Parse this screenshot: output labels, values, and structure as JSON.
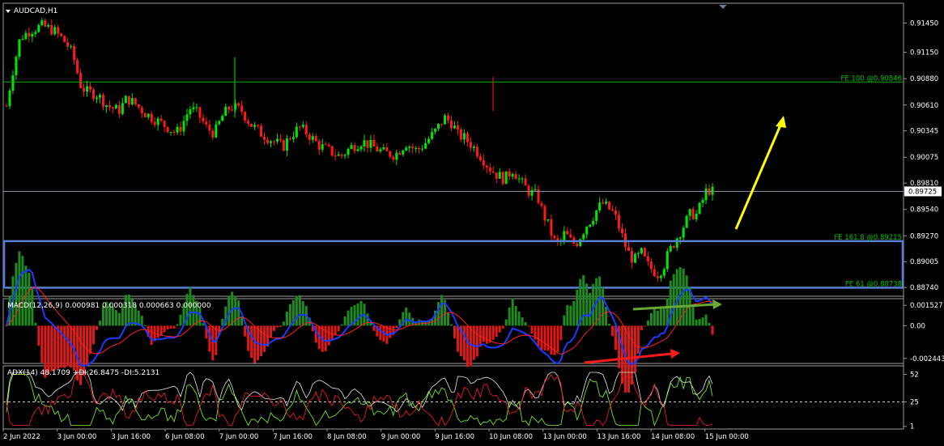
{
  "chart_data": [
    {
      "type": "candlestick",
      "title": "AUDCAD,H1",
      "price_ticks": [
        "0.91450",
        "0.91150",
        "0.90880",
        "0.90610",
        "0.90345",
        "0.90075",
        "0.89810",
        "0.89540",
        "0.89270",
        "0.89005",
        "0.88740"
      ],
      "ylim": [
        0.887,
        0.9162
      ],
      "current_price": "0.89725",
      "fib_levels": [
        {
          "label": "FE 100 @0.90846",
          "value": 0.90846
        },
        {
          "label": "FE 161.8 @0.89215",
          "value": 0.89215
        },
        {
          "label": "FE 61 @0.88738",
          "value": 0.88738
        }
      ],
      "arrow_color": "#ffff00",
      "bull_color": "#00e600",
      "bear_color": "#ff1a1a",
      "zone_color": "#5a7fd6",
      "close_path": [
        [
          0,
          0.906
        ],
        [
          4,
          0.9092
        ],
        [
          10,
          0.913
        ],
        [
          18,
          0.9138
        ],
        [
          26,
          0.9142
        ],
        [
          34,
          0.9138
        ],
        [
          40,
          0.913
        ],
        [
          46,
          0.912
        ],
        [
          50,
          0.9105
        ],
        [
          54,
          0.9082
        ],
        [
          58,
          0.9075
        ],
        [
          66,
          0.9072
        ],
        [
          74,
          0.906
        ],
        [
          82,
          0.9055
        ],
        [
          88,
          0.9068
        ],
        [
          94,
          0.9062
        ],
        [
          102,
          0.9052
        ],
        [
          110,
          0.9045
        ],
        [
          118,
          0.9038
        ],
        [
          124,
          0.9032
        ],
        [
          128,
          0.904
        ],
        [
          134,
          0.9058
        ],
        [
          140,
          0.9052
        ],
        [
          146,
          0.9038
        ],
        [
          152,
          0.9032
        ],
        [
          158,
          0.905
        ],
        [
          164,
          0.906
        ],
        [
          172,
          0.9055
        ],
        [
          178,
          0.9042
        ],
        [
          186,
          0.9032
        ],
        [
          194,
          0.9025
        ],
        [
          202,
          0.9018
        ],
        [
          208,
          0.903
        ],
        [
          214,
          0.9038
        ],
        [
          220,
          0.9032
        ],
        [
          228,
          0.902
        ],
        [
          236,
          0.9014
        ],
        [
          244,
          0.9008
        ],
        [
          252,
          0.9018
        ],
        [
          260,
          0.9024
        ],
        [
          268,
          0.9018
        ],
        [
          276,
          0.9012
        ],
        [
          284,
          0.901
        ],
        [
          292,
          0.9022
        ],
        [
          300,
          0.9014
        ],
        [
          306,
          0.9022
        ],
        [
          314,
          0.9035
        ],
        [
          320,
          0.9048
        ],
        [
          326,
          0.9042
        ],
        [
          330,
          0.903
        ],
        [
          334,
          0.9028
        ],
        [
          340,
          0.902
        ],
        [
          346,
          0.901
        ],
        [
          352,
          0.8998
        ],
        [
          358,
          0.899
        ],
        [
          364,
          0.8985
        ],
        [
          370,
          0.8995
        ],
        [
          376,
          0.8982
        ],
        [
          382,
          0.8972
        ],
        [
          388,
          0.8968
        ],
        [
          392,
          0.895
        ],
        [
          396,
          0.8938
        ],
        [
          400,
          0.8922
        ],
        [
          404,
          0.8918
        ],
        [
          408,
          0.893
        ],
        [
          412,
          0.8922
        ],
        [
          416,
          0.8918
        ],
        [
          420,
          0.8928
        ],
        [
          424,
          0.8938
        ],
        [
          428,
          0.8945
        ],
        [
          432,
          0.8955
        ],
        [
          436,
          0.896
        ],
        [
          440,
          0.8955
        ],
        [
          444,
          0.895
        ],
        [
          448,
          0.8935
        ],
        [
          452,
          0.8918
        ],
        [
          456,
          0.8905
        ],
        [
          460,
          0.8902
        ],
        [
          464,
          0.891
        ],
        [
          468,
          0.8898
        ],
        [
          472,
          0.8892
        ],
        [
          476,
          0.8888
        ],
        [
          480,
          0.8895
        ],
        [
          484,
          0.891
        ],
        [
          488,
          0.892
        ],
        [
          492,
          0.893
        ],
        [
          496,
          0.894
        ],
        [
          500,
          0.895
        ],
        [
          504,
          0.8948
        ],
        [
          508,
          0.896
        ],
        [
          512,
          0.8975
        ],
        [
          516,
          0.8972
        ]
      ],
      "macd": {
        "label": "MACD(12,26,9) 0.000981 0.000318 0.000663 0.000000",
        "ticks": [
          "0.001527",
          "0.00",
          "-0.002443"
        ],
        "ylim": [
          -0.0027,
          0.0019
        ],
        "arrow_color": "#66a832",
        "arrow_color_low": "#ff1a1a"
      },
      "adx": {
        "label": "ADX(14) 48.1709 +DI:26.8475 -DI:5.2131",
        "ticks": [
          "52",
          "25",
          "1"
        ],
        "ylim": [
          0,
          58
        ],
        "level": 25
      },
      "x_ticks": [
        "2 Jun 2022",
        "3 Jun 00:00",
        "3 Jun 16:00",
        "6 Jun 08:00",
        "7 Jun 00:00",
        "7 Jun 16:00",
        "8 Jun 08:00",
        "9 Jun 00:00",
        "9 Jun 16:00",
        "10 Jun 08:00",
        "13 Jun 00:00",
        "13 Jun 16:00",
        "14 Jun 08:00",
        "15 Jun 00:00"
      ]
    }
  ]
}
